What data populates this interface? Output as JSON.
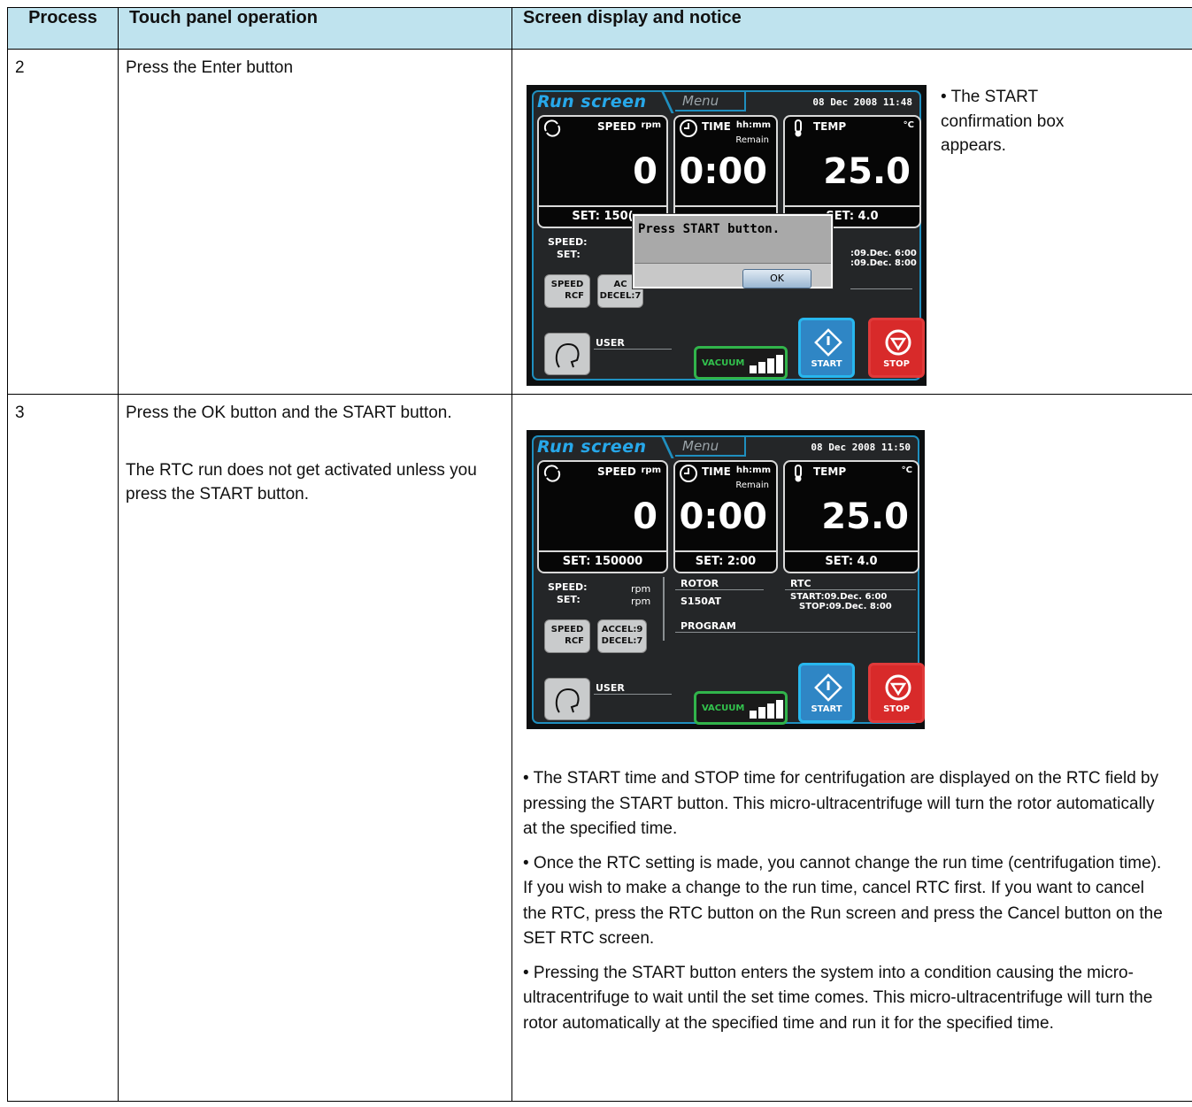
{
  "headers": {
    "process": "Process",
    "operation": "Touch panel operation",
    "display": "Screen display and notice"
  },
  "rows": [
    {
      "process": "2",
      "operation": "Press the Enter button",
      "notice": "• The START confirmation box appears.",
      "screen": {
        "title": "Run screen",
        "menu": "Menu",
        "datetime": "08 Dec 2008 11:48",
        "speed_label": "SPEED",
        "speed_unit": "rpm",
        "speed_value": "0",
        "speed_set": "SET: 150(",
        "time_label": "TIME",
        "time_unit": "hh:mm",
        "time_remain": "Remain",
        "time_value": "0:00",
        "temp_label": "TEMP",
        "temp_unit": "°C",
        "temp_value": "25.0",
        "temp_set": "SET: 4.0",
        "speed_sub": "SPEED:",
        "set_sub": "SET:",
        "rtc_start": ":09.Dec. 6:00",
        "rtc_stop": ":09.Dec. 8:00",
        "btn_speed": "SPEED",
        "btn_rcf": "RCF",
        "btn_accel": "AC",
        "btn_decel": "DECEL:7",
        "user": "USER",
        "vacuum": "VACUUM",
        "start": "START",
        "stop": "STOP",
        "dialog_msg": "Press START button.",
        "dialog_ok": "OK"
      }
    },
    {
      "process": "3",
      "operation": "Press the OK button and the START button.",
      "operation_note": "The RTC run does not get activated unless you press the START button.",
      "screen": {
        "title": "Run screen",
        "menu": "Menu",
        "datetime": "08 Dec 2008 11:50",
        "speed_label": "SPEED",
        "speed_unit": "rpm",
        "speed_value": "0",
        "speed_set": "SET: 150000",
        "time_label": "TIME",
        "time_unit": "hh:mm",
        "time_remain": "Remain",
        "time_value": "0:00",
        "time_set": "SET: 2:00",
        "temp_label": "TEMP",
        "temp_unit": "°C",
        "temp_value": "25.0",
        "temp_set": "SET: 4.0",
        "speed_sub": "SPEED:",
        "set_sub": "SET:",
        "rpm1": "rpm",
        "rpm2": "rpm",
        "rotor_label": "ROTOR",
        "rotor_value": "S150AT",
        "rtc_label": "RTC",
        "rtc_start": "START:09.Dec. 6:00",
        "rtc_stop": "STOP:09.Dec. 8:00",
        "program_label": "PROGRAM",
        "btn_speed": "SPEED",
        "btn_rcf": "RCF",
        "btn_accel": "ACCEL:9",
        "btn_decel": "DECEL:7",
        "user": "USER",
        "vacuum": "VACUUM",
        "start": "START",
        "stop": "STOP"
      },
      "notices": [
        "• The START time and STOP time for centrifugation are displayed on the RTC field by pressing the START button. This micro-ultracentrifuge will turn the rotor automatically at the specified time.",
        "• Once the RTC setting is made, you cannot change the run time (centrifugation time). If you wish to make a change to the run time, cancel RTC first. If you want to cancel the RTC, press the RTC button on the Run screen and press the Cancel button on the SET RTC screen.",
        "• Pressing the START button enters the system into a condition causing the micro-ultracentrifuge to wait until the set time comes. This micro-ultracentrifuge will turn the rotor automatically at the specified time and run it for the specified time."
      ]
    }
  ]
}
